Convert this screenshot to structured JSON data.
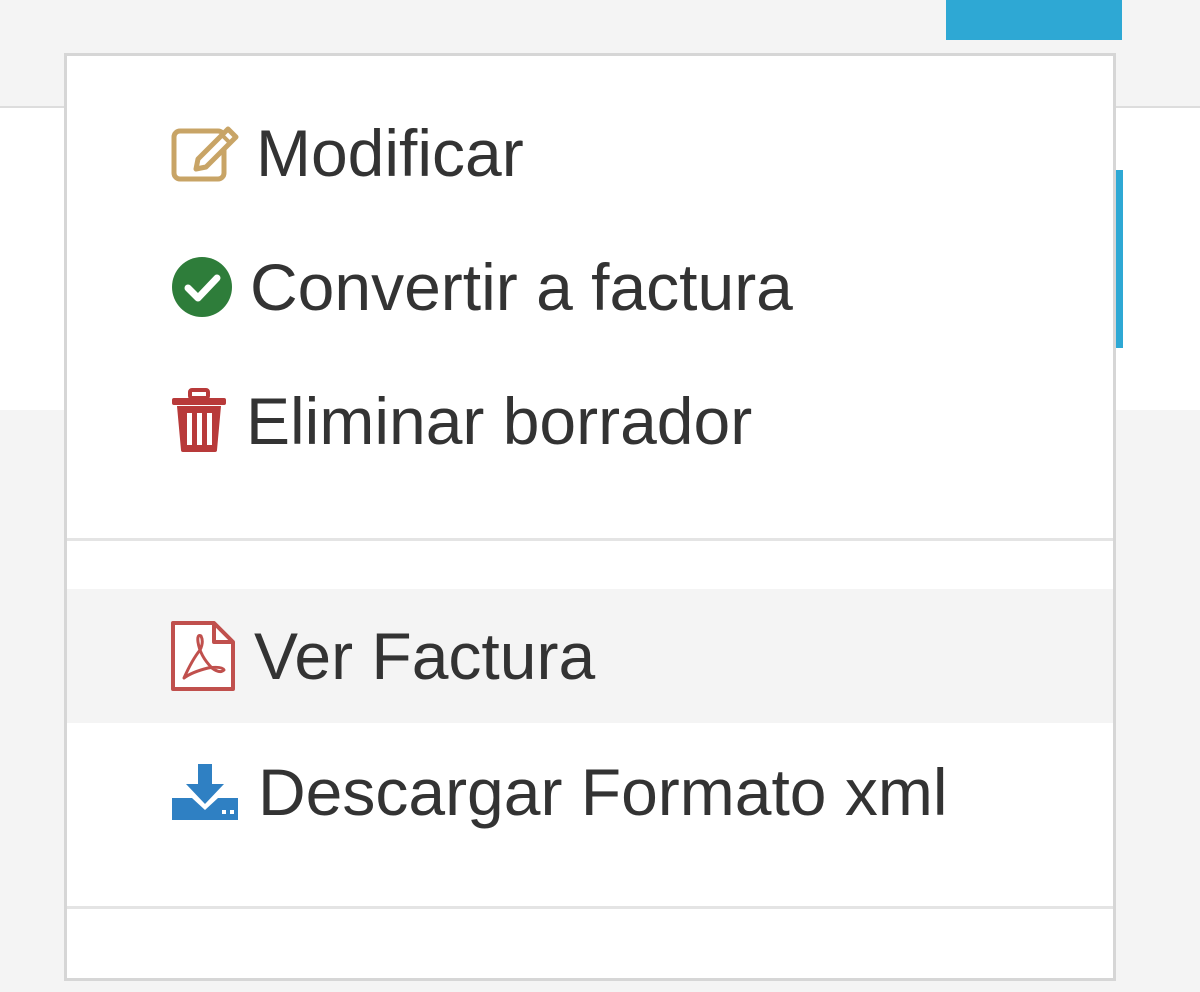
{
  "menu": {
    "section_edit": [
      {
        "label": "Modificar",
        "icon": "edit-icon",
        "color": "#c8a466"
      },
      {
        "label": "Convertir a factura",
        "icon": "check-circle-icon",
        "color": "#2e7d3a"
      },
      {
        "label": "Eliminar borrador",
        "icon": "trash-icon",
        "color": "#b83a3a"
      }
    ],
    "section_files": [
      {
        "label": "Ver Factura",
        "icon": "pdf-file-icon",
        "color": "#c0504d",
        "hovered": true
      },
      {
        "label": "Descargar Formato xml",
        "icon": "download-icon",
        "color": "#2f80c3"
      }
    ]
  },
  "colors": {
    "accent": "#2ea8d4",
    "text": "#333333",
    "hover_bg": "#f4f4f4",
    "border": "#d6d6d6"
  }
}
